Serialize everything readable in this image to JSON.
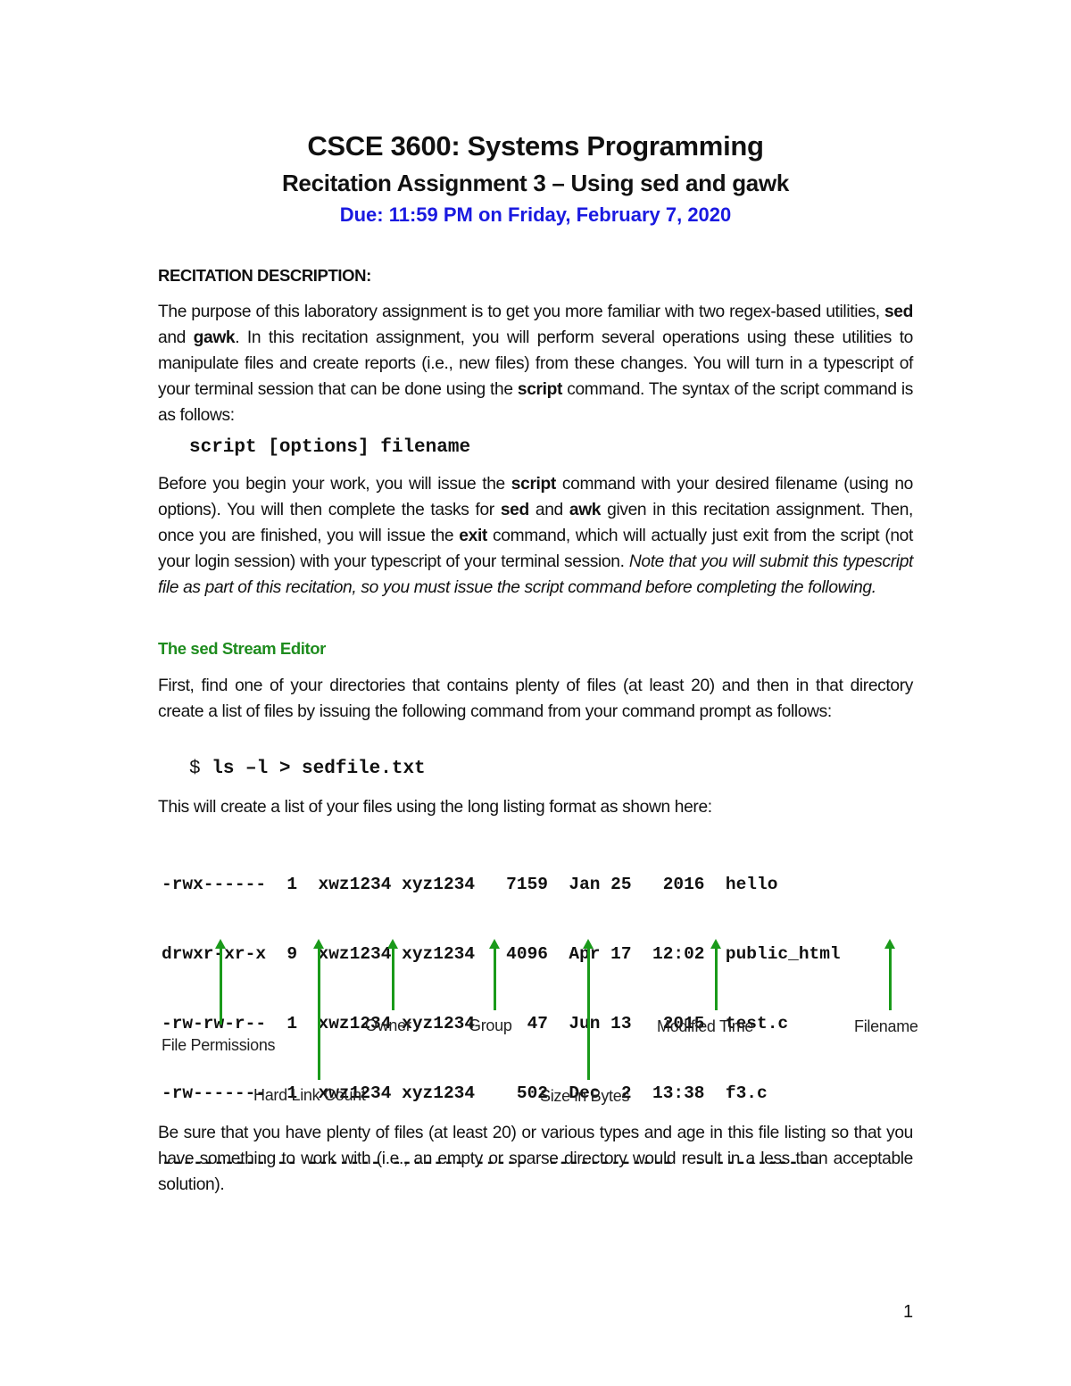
{
  "header": {
    "course_title": "CSCE 3600: Systems Programming",
    "assignment_title": "Recitation Assignment 3 – Using sed and gawk",
    "due": "Due: 11:59 PM on Friday, February 7, 2020"
  },
  "section_heading": "RECITATION DESCRIPTION:",
  "intro": {
    "p1_a": "The purpose of this laboratory assignment is to get you more familiar with two regex-based utilities, ",
    "p1_sed": "sed",
    "p1_b": " and ",
    "p1_gawk": "gawk",
    "p1_c": ". In this recitation assignment, you will perform several operations using these utilities to manipulate files and create reports (i.e., new files) from these changes. You will turn in a typescript of your terminal session that can be done using the ",
    "p1_script": "script",
    "p1_d": " command. The syntax of the script command is as follows:",
    "syntax": "script [options] filename"
  },
  "before": {
    "a": "Before you begin your work, you will issue the ",
    "script": "script",
    "b": " command with your desired filename (using no options). You will then complete the tasks for ",
    "sed": "sed",
    "c": " and ",
    "awk": "awk",
    "d": " given in this recitation assignment. Then, once you are finished, you will issue the ",
    "exit": "exit",
    "e": " command, which will actually just exit from the script (not your login session) with your typescript of your terminal session. ",
    "note": "Note that you will submit this typescript file as part of this recitation, so you must issue the script command before completing the following."
  },
  "sed_section": {
    "heading": "The sed Stream Editor",
    "p1": "First, find one of your directories that contains plenty of files (at least 20) and then in that directory create a list of files by issuing the following command from your command prompt as follows:",
    "prompt": "$ ",
    "command": "ls –l > sedfile.txt",
    "p2": "This will create a list of your files using the long listing format as shown here:"
  },
  "listing": {
    "rows": [
      "-rwx------  1  xwz1234 xyz1234   7159  Jan 25   2016  hello",
      "drwxr-xr-x  9  xwz1234 xyz1234   4096  Apr 17  12:02  public_html",
      "-rw-rw-r--  1  xwz1234 xyz1234     47  Jun 13   2015  test.c",
      "-rw-------  1  xwz1234 xyz1234    502  Dec  2  13:38  f3.c"
    ],
    "underline": "---------- -- ------- ------- -----  ------------  ------------",
    "labels": {
      "permissions": "File Permissions",
      "links": "Hard Link Count",
      "owner": "Owner",
      "group": "Group",
      "size": "Size in Bytes",
      "modified": "Modified Time",
      "filename": "Filename"
    },
    "arrow_color": "#1a9a1a"
  },
  "closing": "Be sure that you have plenty of files (at least 20) or various types and age in this file listing so that you have something to work with (i.e., an empty or sparse directory would result in a less than acceptable solution).",
  "page_number": "1",
  "colors": {
    "due": "#1a1ae0",
    "heading_green": "#1e8c1e"
  }
}
